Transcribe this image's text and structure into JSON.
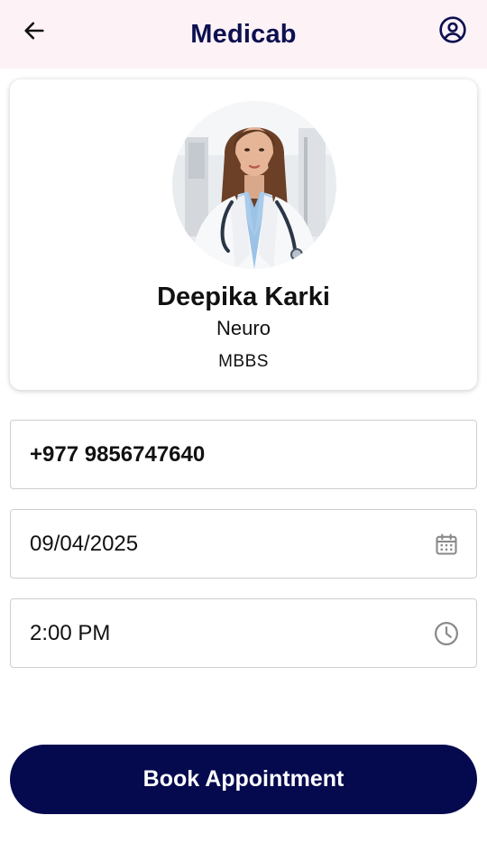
{
  "appbar": {
    "title": "Medicab",
    "back_icon": "arrow-left-icon",
    "profile_icon": "account-circle-icon"
  },
  "doctor": {
    "name": "Deepika Karki",
    "specialty": "Neuro",
    "degree": "MBBS",
    "photo": "doctor-portrait"
  },
  "form": {
    "phone": "+977 9856747640",
    "date": "09/04/2025",
    "date_icon": "calendar-icon",
    "time": "2:00 PM",
    "time_icon": "clock-icon"
  },
  "actions": {
    "book_label": "Book Appointment"
  },
  "colors": {
    "appbar_bg": "#fdf3f7",
    "brand_navy": "#050a4f",
    "title_color": "#0d1050",
    "icon_gray": "#8a8a8a"
  }
}
